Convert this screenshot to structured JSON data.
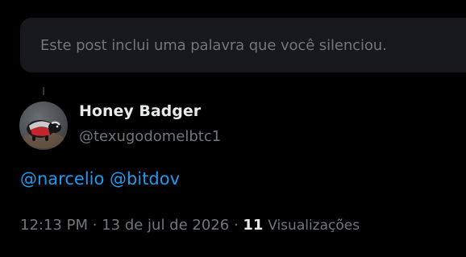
{
  "muted_notice": {
    "text": "Este post inclui uma palavra que você silenciou."
  },
  "post": {
    "author": {
      "display_name": "Honey Badger",
      "handle": "@texugodomelbtc1",
      "avatar_icon": "honey-badger-avatar"
    },
    "mentions": [
      "@narcelio",
      "@bitdov"
    ],
    "time": "12:13 PM",
    "separator": "·",
    "date": "13 de jul de 2026",
    "views_count": "11",
    "views_label": "Visualizações"
  },
  "colors": {
    "background": "#000000",
    "notice_bg": "#16181c",
    "muted_text": "#71767b",
    "primary_text": "#e7e9ea",
    "link": "#1d9bf0"
  }
}
